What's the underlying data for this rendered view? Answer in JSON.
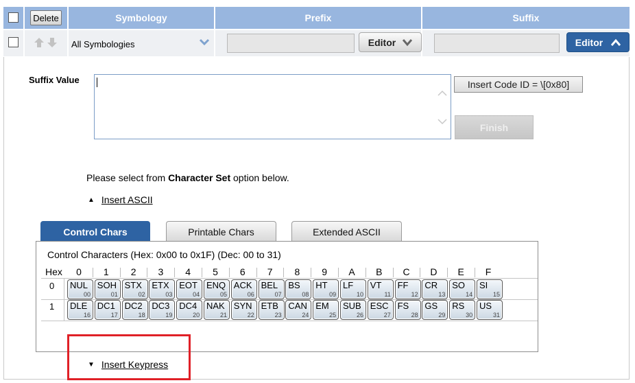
{
  "header": {
    "delete_label": "Delete",
    "symbology_label": "Symbology",
    "prefix_label": "Prefix",
    "suffix_label": "Suffix"
  },
  "row": {
    "symbology_value": "All Symbologies",
    "prefix_editor_label": "Editor",
    "suffix_editor_label": "Editor"
  },
  "suffix": {
    "label": "Suffix Value",
    "value": "",
    "insert_code_label": "Insert Code ID = \\[0x80]",
    "finish_label": "Finish"
  },
  "instructions": {
    "pre": "Please select from ",
    "bold": "Character Set",
    "post": " option below."
  },
  "insert_ascii_label": "Insert ASCII",
  "insert_keypress_label": "Insert Keypress",
  "tabs": [
    {
      "label": "Control Chars",
      "active": true
    },
    {
      "label": "Printable Chars",
      "active": false
    },
    {
      "label": "Extended ASCII",
      "active": false
    }
  ],
  "charset": {
    "title": "Control Characters (Hex: 0x00 to 0x1F) (Dec: 00 to 31)",
    "hex_label": "Hex",
    "columns": [
      "0",
      "1",
      "2",
      "3",
      "4",
      "5",
      "6",
      "7",
      "8",
      "9",
      "A",
      "B",
      "C",
      "D",
      "E",
      "F"
    ],
    "rows": [
      {
        "head": "0",
        "keys": [
          {
            "name": "NUL",
            "code": "00"
          },
          {
            "name": "SOH",
            "code": "01"
          },
          {
            "name": "STX",
            "code": "02"
          },
          {
            "name": "ETX",
            "code": "03"
          },
          {
            "name": "EOT",
            "code": "04"
          },
          {
            "name": "ENQ",
            "code": "05"
          },
          {
            "name": "ACK",
            "code": "06"
          },
          {
            "name": "BEL",
            "code": "07"
          },
          {
            "name": "BS",
            "code": "08"
          },
          {
            "name": "HT",
            "code": "09"
          },
          {
            "name": "LF",
            "code": "10"
          },
          {
            "name": "VT",
            "code": "11"
          },
          {
            "name": "FF",
            "code": "12"
          },
          {
            "name": "CR",
            "code": "13"
          },
          {
            "name": "SO",
            "code": "14"
          },
          {
            "name": "SI",
            "code": "15"
          }
        ]
      },
      {
        "head": "1",
        "keys": [
          {
            "name": "DLE",
            "code": "16"
          },
          {
            "name": "DC1",
            "code": "17"
          },
          {
            "name": "DC2",
            "code": "18"
          },
          {
            "name": "DC3",
            "code": "19"
          },
          {
            "name": "DC4",
            "code": "20"
          },
          {
            "name": "NAK",
            "code": "21"
          },
          {
            "name": "SYN",
            "code": "22"
          },
          {
            "name": "ETB",
            "code": "23"
          },
          {
            "name": "CAN",
            "code": "24"
          },
          {
            "name": "EM",
            "code": "25"
          },
          {
            "name": "SUB",
            "code": "26"
          },
          {
            "name": "ESC",
            "code": "27"
          },
          {
            "name": "FS",
            "code": "28"
          },
          {
            "name": "GS",
            "code": "29"
          },
          {
            "name": "RS",
            "code": "30"
          },
          {
            "name": "US",
            "code": "31"
          }
        ]
      }
    ]
  },
  "colors": {
    "header_bg": "#98b6df",
    "accent_blue": "#2e63a3",
    "highlight_red": "#e02027"
  },
  "icons": [
    "up-arrow-icon",
    "down-arrow-icon",
    "chevron-down-icon",
    "chevron-up-icon",
    "triangle-up-icon",
    "triangle-down-icon"
  ]
}
